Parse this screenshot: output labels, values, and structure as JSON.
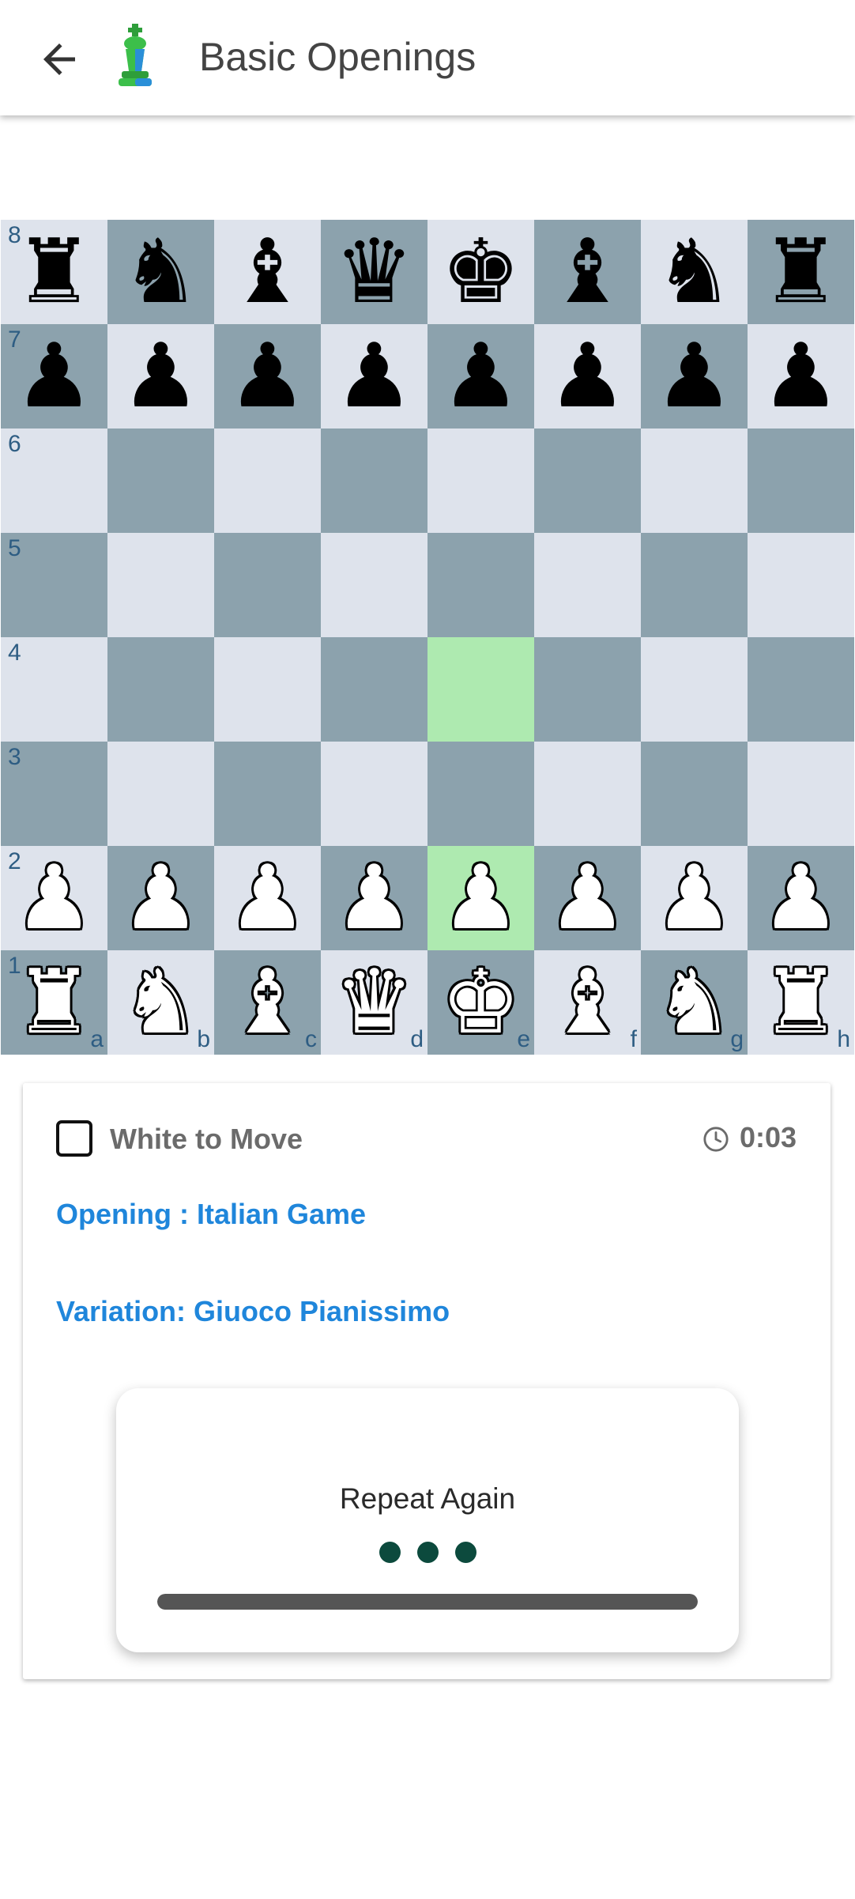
{
  "app_bar": {
    "title": "Basic Openings",
    "back_icon": "arrow-left-icon",
    "logo_icon": "green-chess-king-logo-icon"
  },
  "board": {
    "colors": {
      "light": "#dee3ec",
      "dark": "#8ca2ad",
      "highlight": "#aeeab0",
      "label": "#2e5d83"
    },
    "ranks": [
      "8",
      "7",
      "6",
      "5",
      "4",
      "3",
      "2",
      "1"
    ],
    "files": [
      "a",
      "b",
      "c",
      "d",
      "e",
      "f",
      "g",
      "h"
    ],
    "position": [
      [
        "r",
        "n",
        "b",
        "q",
        "k",
        "b",
        "n",
        "r"
      ],
      [
        "p",
        "p",
        "p",
        "p",
        "p",
        "p",
        "p",
        "p"
      ],
      [
        "",
        "",
        "",
        "",
        "",
        "",
        "",
        ""
      ],
      [
        "",
        "",
        "",
        "",
        "",
        "",
        "",
        ""
      ],
      [
        "",
        "",
        "",
        "",
        "",
        "",
        "",
        ""
      ],
      [
        "",
        "",
        "",
        "",
        "",
        "",
        "",
        ""
      ],
      [
        "P",
        "P",
        "P",
        "P",
        "P",
        "P",
        "P",
        "P"
      ],
      [
        "R",
        "N",
        "B",
        "Q",
        "K",
        "B",
        "N",
        "R"
      ]
    ],
    "highlighted_squares": [
      "e4",
      "e2"
    ]
  },
  "status": {
    "turn_label": "White to Move",
    "turn_checked": false,
    "clock_icon": "clock-icon",
    "clock_value": "0:03"
  },
  "opening": {
    "opening_text": "Opening : Italian Game",
    "variation_text": "Variation: Giuoco Pianissimo",
    "accent_color": "#1f86db"
  },
  "repeat_dialog": {
    "label": "Repeat Again",
    "dot_color": "#0c4a3d",
    "progress_percent": 100
  }
}
